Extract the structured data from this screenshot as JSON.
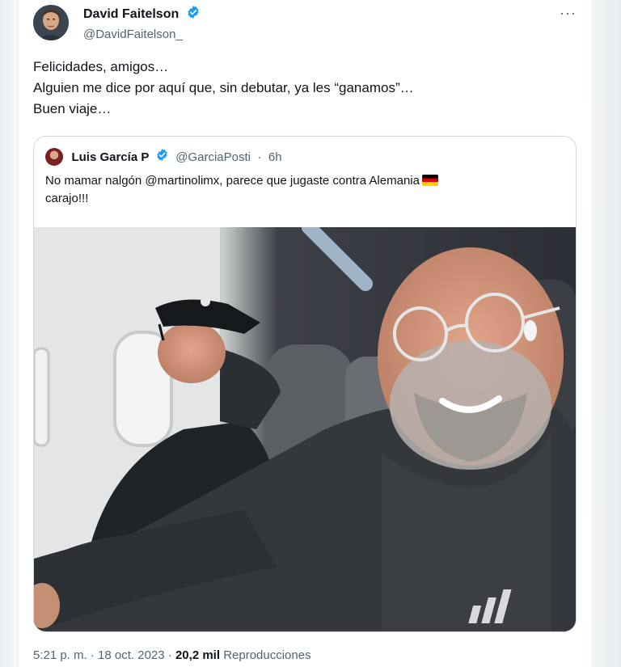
{
  "tweet": {
    "author": {
      "name": "David Faitelson",
      "handle": "@DavidFaitelson_",
      "verified": true
    },
    "more_icon": "more-dots-icon",
    "lines": [
      "Felicidades, amigos…",
      "Alguien me dice por aquí que, sin debutar, ya les “ganamos”…",
      "Buen viaje…"
    ],
    "quote": {
      "name": "Luis García P",
      "handle": "@GarciaPosti",
      "separator": "·",
      "time": "6h",
      "text_line1": "No mamar nalgón @martinolimx, parece que jugaste contra Alemania",
      "text_line2": "carajo!!!",
      "flag": "germany-flag-emoji"
    },
    "footer": {
      "time": "5:21 p. m.",
      "separator1": "·",
      "date": "18 oct. 2023",
      "separator2": "·",
      "views_count": "20,2 mil",
      "views_label": "Reproducciones"
    }
  },
  "colors": {
    "text": "#0f1419",
    "secondary": "#536471",
    "border": "#cfd9de",
    "verified": "#1d9bf0"
  }
}
